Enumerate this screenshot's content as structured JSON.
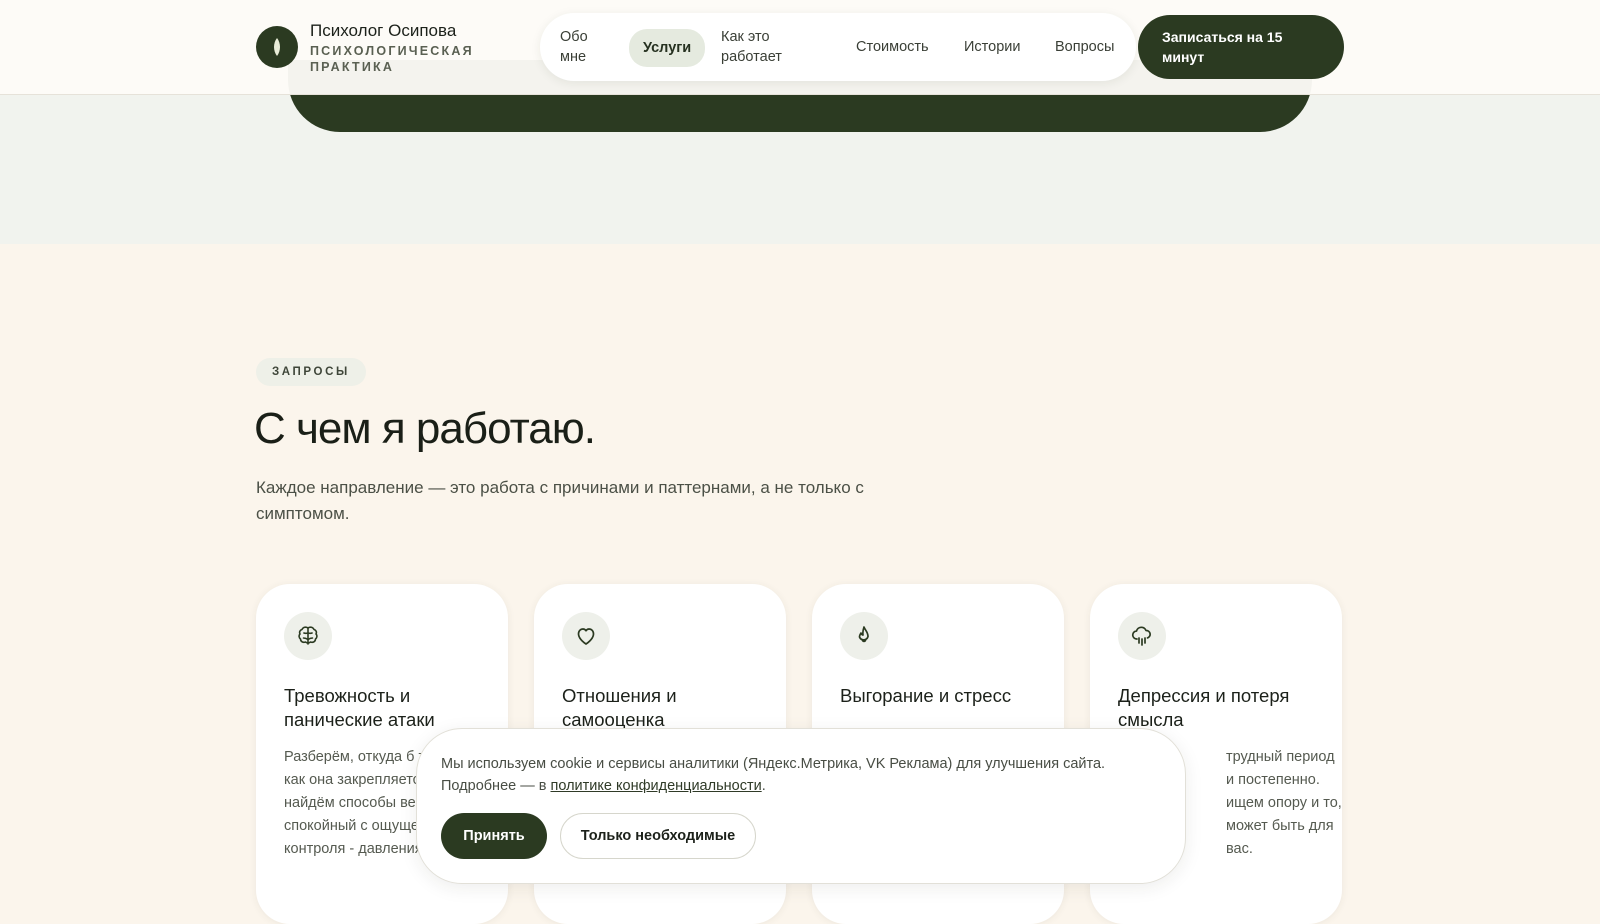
{
  "header": {
    "brand_name": "Психолог Осипова",
    "brand_subtitle": "ПСИХОЛОГИЧЕСКАЯ ПРАКТИКА",
    "logo_icon": "leaf-icon",
    "nav": [
      {
        "label": "Обо мне",
        "active": false
      },
      {
        "label": "Услуги",
        "active": true
      },
      {
        "label": "Как это работает",
        "active": false
      },
      {
        "label": "Стоимость",
        "active": false
      },
      {
        "label": "Истории",
        "active": false
      },
      {
        "label": "Вопросы",
        "active": false
      }
    ],
    "cta_label": "Записаться на 15 минут"
  },
  "section": {
    "tag": "ЗАПРОСЫ",
    "title": "С чем я работаю.",
    "lead": "Каждое направление — это работа с причинами и паттернами, а не только с симптомом."
  },
  "cards": [
    {
      "icon": "brain-icon",
      "title": "Тревожность и панические атаки",
      "text": "Разберём, откуда б тревога и как она закрепляется. Вмес найдём способы ве более спокойный с ощущение контроля - давления."
    },
    {
      "icon": "heart-icon",
      "title": "Отношения и самооценка",
      "text": ""
    },
    {
      "icon": "flame-icon",
      "title": "Выгорание и стресс",
      "text": ""
    },
    {
      "icon": "cloud-rain-icon",
      "title": "Депрессия и потеря смысла",
      "text": "трудный период и постепенно. ищем опору и то, может быть для вас."
    }
  ],
  "cookie": {
    "text_before": "Мы используем cookie и сервисы аналитики (Яндекс.Метрика, VK Реклама) для улучшения сайта. Подробнее — в ",
    "link_text": "политике конфиденциальности",
    "text_after": ".",
    "accept_label": "Принять",
    "essential_label": "Только необходимые"
  },
  "colors": {
    "accent": "#2b3a21",
    "page_background": "#fbf5ec",
    "top_band": "#f1f3ee"
  }
}
